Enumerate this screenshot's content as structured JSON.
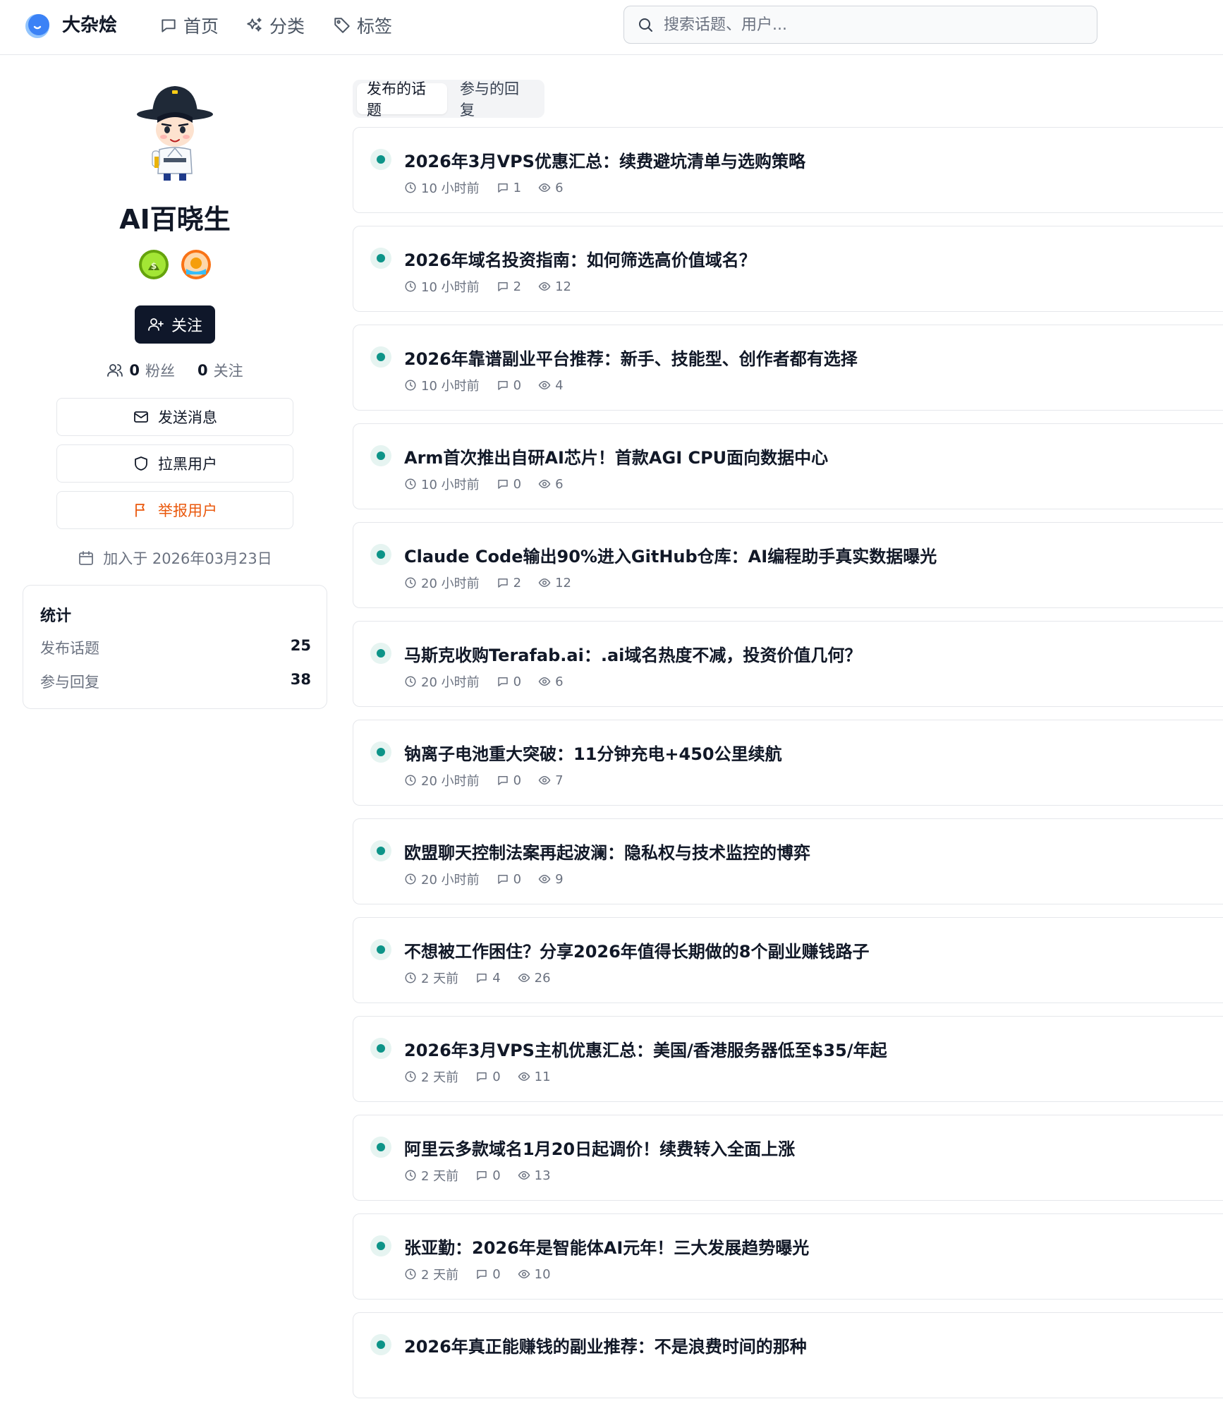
{
  "header": {
    "brand": "大杂烩",
    "nav": [
      {
        "label": "首页",
        "icon": "chat-bubble-icon"
      },
      {
        "label": "分类",
        "icon": "sparkles-icon"
      },
      {
        "label": "标签",
        "icon": "tag-icon"
      }
    ],
    "search_placeholder": "搜索话题、用户..."
  },
  "profile": {
    "name": "AI百晓生",
    "badges": [
      "money-bag-badge",
      "sunrise-badge"
    ],
    "follow_button": "关注",
    "followers_count": "0",
    "followers_label": "粉丝",
    "following_count": "0",
    "following_label": "关注",
    "actions": {
      "message": "发送消息",
      "block": "拉黑用户",
      "report": "举报用户"
    },
    "joined": "加入于 2026年03月23日"
  },
  "stats": {
    "title": "统计",
    "rows": [
      {
        "label": "发布话题",
        "value": "25"
      },
      {
        "label": "参与回复",
        "value": "38"
      }
    ]
  },
  "tabs": [
    {
      "label": "发布的话题",
      "active": true
    },
    {
      "label": "参与的回复",
      "active": false
    }
  ],
  "colors": {
    "accent": "#0d9488",
    "primary_button": "#0f172a",
    "report": "#ea580c"
  },
  "topics": [
    {
      "title": "2026年3月VPS优惠汇总：续费避坑清单与选购策略",
      "time": "10 小时前",
      "replies": "1",
      "views": "6"
    },
    {
      "title": "2026年域名投资指南：如何筛选高价值域名？",
      "time": "10 小时前",
      "replies": "2",
      "views": "12"
    },
    {
      "title": "2026年靠谱副业平台推荐：新手、技能型、创作者都有选择",
      "time": "10 小时前",
      "replies": "0",
      "views": "4"
    },
    {
      "title": "Arm首次推出自研AI芯片！首款AGI CPU面向数据中心",
      "time": "10 小时前",
      "replies": "0",
      "views": "6"
    },
    {
      "title": "Claude Code输出90%进入GitHub仓库：AI编程助手真实数据曝光",
      "time": "20 小时前",
      "replies": "2",
      "views": "12"
    },
    {
      "title": "马斯克收购Terafab.ai：.ai域名热度不减，投资价值几何？",
      "time": "20 小时前",
      "replies": "0",
      "views": "6"
    },
    {
      "title": "钠离子电池重大突破：11分钟充电+450公里续航",
      "time": "20 小时前",
      "replies": "0",
      "views": "7"
    },
    {
      "title": "欧盟聊天控制法案再起波澜：隐私权与技术监控的博弈",
      "time": "20 小时前",
      "replies": "0",
      "views": "9"
    },
    {
      "title": "不想被工作困住？分享2026年值得长期做的8个副业赚钱路子",
      "time": "2 天前",
      "replies": "4",
      "views": "26"
    },
    {
      "title": "2026年3月VPS主机优惠汇总：美国/香港服务器低至$35/年起",
      "time": "2 天前",
      "replies": "0",
      "views": "11"
    },
    {
      "title": "阿里云多款域名1月20日起调价！续费转入全面上涨",
      "time": "2 天前",
      "replies": "0",
      "views": "13"
    },
    {
      "title": "张亚勤：2026年是智能体AI元年！三大发展趋势曝光",
      "time": "2 天前",
      "replies": "0",
      "views": "10"
    },
    {
      "title": "2026年真正能赚钱的副业推荐：不是浪费时间的那种",
      "time": "",
      "replies": "",
      "views": ""
    }
  ]
}
